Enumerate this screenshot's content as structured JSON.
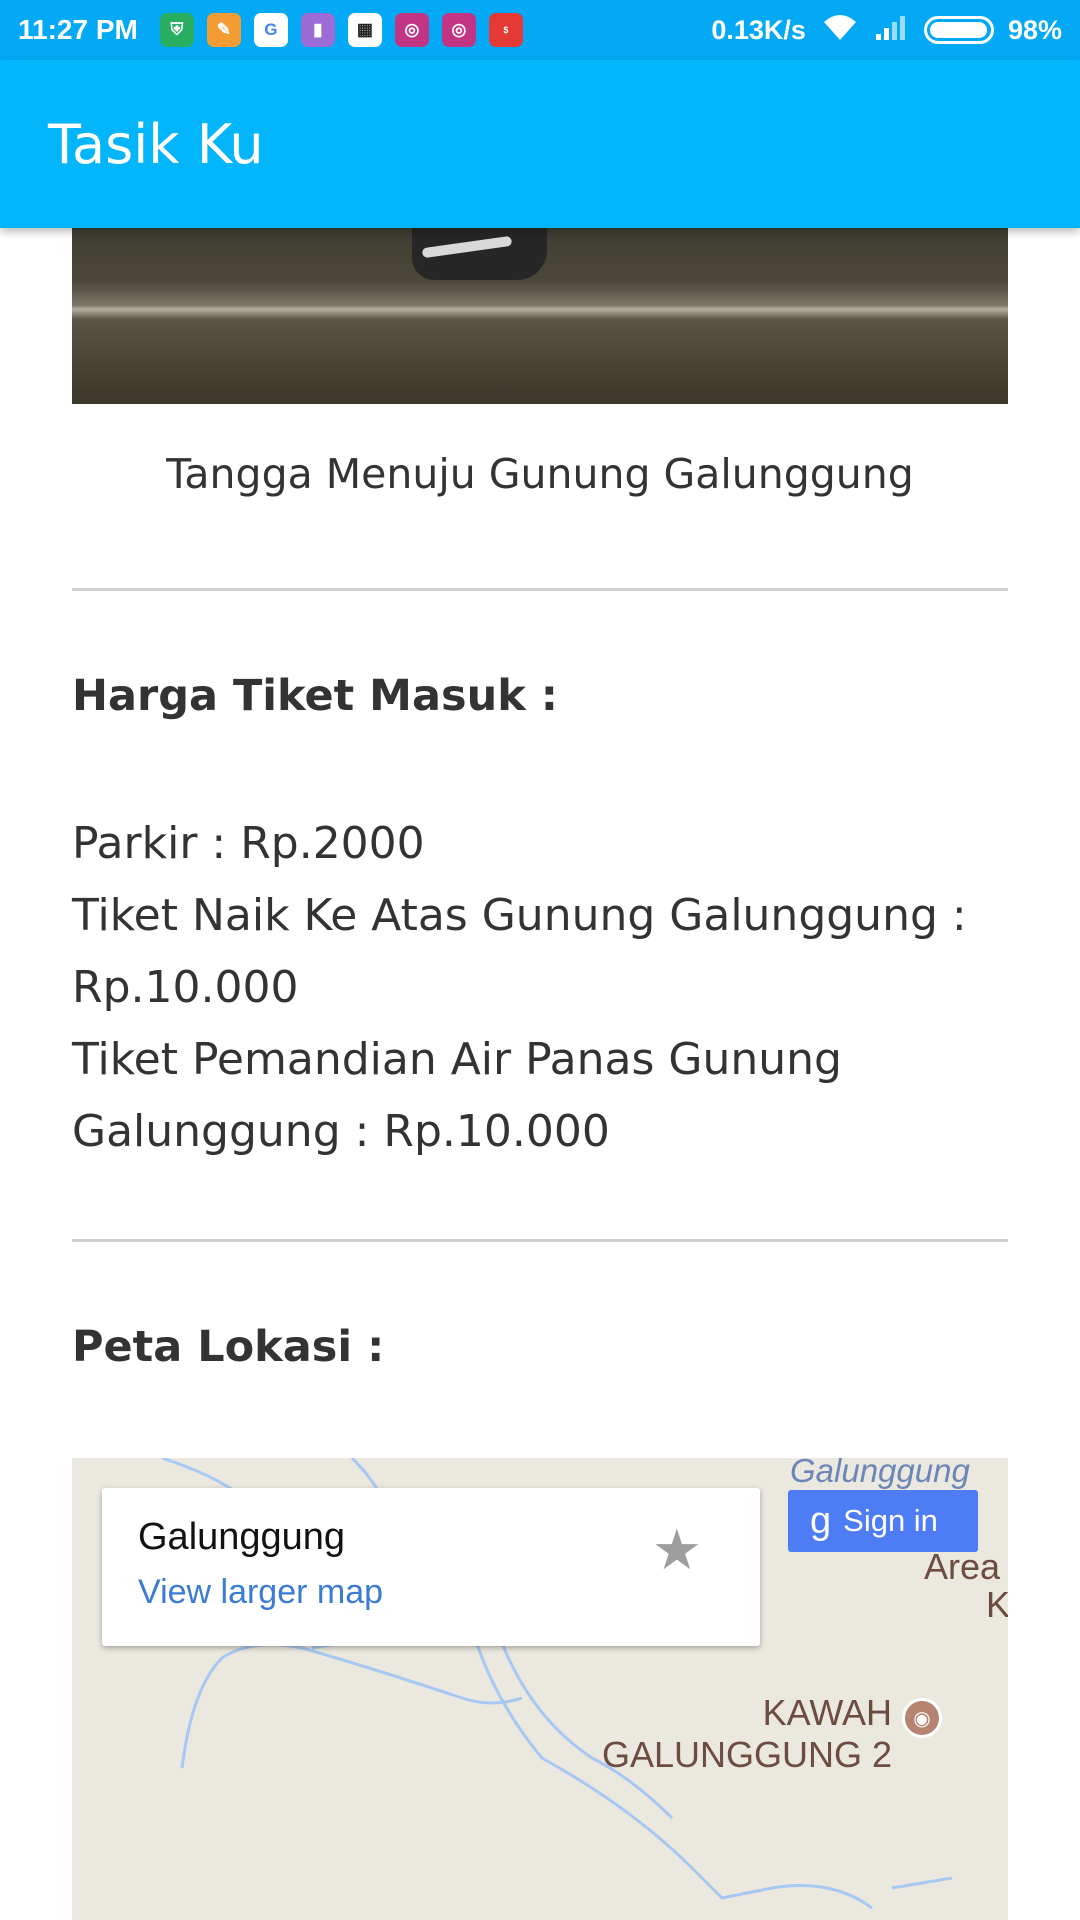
{
  "status_bar": {
    "time": "11:27 PM",
    "network_speed": "0.13K/s",
    "battery": "98%",
    "battery_level": 0.98,
    "notification_icons": [
      "shield-app-icon",
      "brush-app-icon",
      "google-icon",
      "files-app-icon",
      "bbm-icon",
      "instagram-icon",
      "instagram-icon",
      "money-lover-icon"
    ]
  },
  "app_bar": {
    "title": "Tasik Ku"
  },
  "content": {
    "photo_caption": "Tangga Menuju Gunung Galunggung",
    "ticket_heading": "Harga Tiket Masuk :",
    "ticket_lines": [
      "Parkir : Rp.2000",
      "Tiket Naik Ke Atas Gunung Galunggung : Rp.10.000",
      "Tiket Pemandian Air Panas Gunung Galunggung : Rp.10.000"
    ],
    "map_heading": "Peta Lokasi :"
  },
  "map": {
    "place_name": "Galunggung",
    "larger_map_link": "View larger map",
    "sign_in_label": "Sign in",
    "top_label": "Galunggung",
    "area_label_1": "Area",
    "area_label_2": "K",
    "poi_line_1": "KAWAH",
    "poi_line_2": "GALUNGGUNG 2"
  },
  "colors": {
    "status_bar": "#03a9f4",
    "app_bar": "#03b5fb",
    "link": "#3a7bd5",
    "sign_in_button": "#4d7cf4",
    "map_background": "#ebe8df"
  }
}
